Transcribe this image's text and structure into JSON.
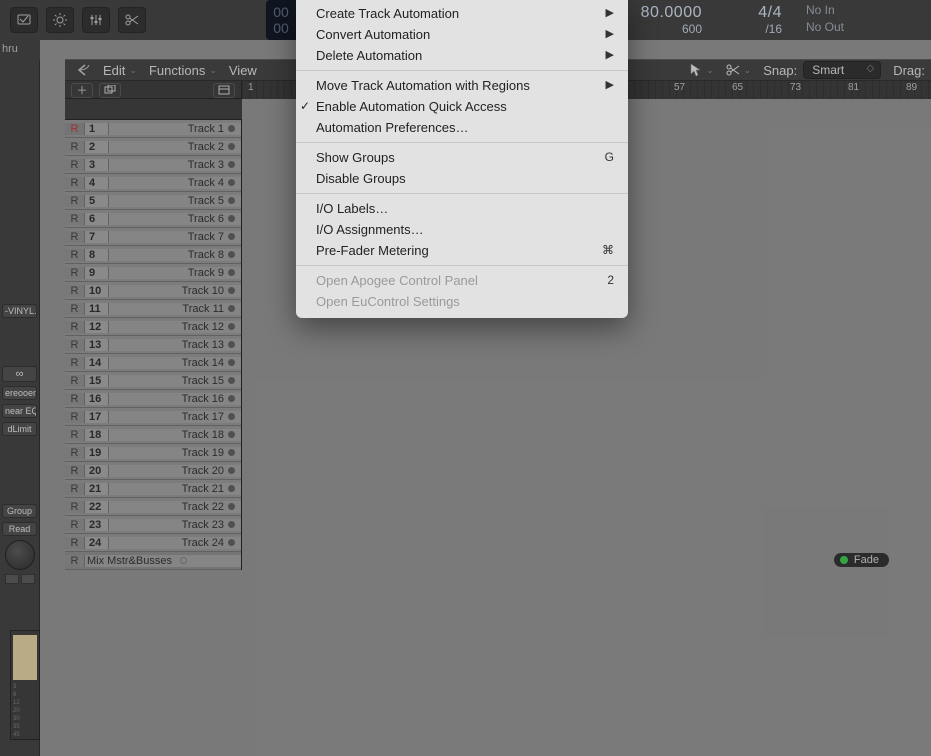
{
  "toolbar": {
    "icons": [
      "screen-icon",
      "sun-icon",
      "sliders-icon",
      "scissors-icon"
    ]
  },
  "lcd": {
    "edge1": "00",
    "edge2": "00",
    "tempo": "80.0000",
    "beat": "600",
    "timesig": "4/4",
    "division": "/16",
    "io_in": "No In",
    "io_out": "No Out"
  },
  "left_header": "hru",
  "menubar": {
    "edit": "Edit",
    "functions": "Functions",
    "view": "View",
    "snap_label": "Snap:",
    "snap_value": "Smart",
    "drag_label": "Drag:"
  },
  "ruler": {
    "first_marker": "1",
    "marks": [
      "57",
      "65",
      "73",
      "81",
      "89"
    ]
  },
  "inspector": {
    "chips": [
      "-VINYL…",
      "∞",
      "ereooere",
      "near EQ",
      "dLimit",
      "Group",
      "Read"
    ]
  },
  "tracks": [
    {
      "n": "1",
      "name": "Track 1"
    },
    {
      "n": "2",
      "name": "Track 2"
    },
    {
      "n": "3",
      "name": "Track 3"
    },
    {
      "n": "4",
      "name": "Track 4"
    },
    {
      "n": "5",
      "name": "Track 5"
    },
    {
      "n": "6",
      "name": "Track 6"
    },
    {
      "n": "7",
      "name": "Track 7"
    },
    {
      "n": "8",
      "name": "Track 8"
    },
    {
      "n": "9",
      "name": "Track 9"
    },
    {
      "n": "10",
      "name": "Track 10"
    },
    {
      "n": "11",
      "name": "Track 11"
    },
    {
      "n": "12",
      "name": "Track 12"
    },
    {
      "n": "13",
      "name": "Track 13"
    },
    {
      "n": "14",
      "name": "Track 14"
    },
    {
      "n": "15",
      "name": "Track 15"
    },
    {
      "n": "16",
      "name": "Track 16"
    },
    {
      "n": "17",
      "name": "Track 17"
    },
    {
      "n": "18",
      "name": "Track 18"
    },
    {
      "n": "19",
      "name": "Track 19"
    },
    {
      "n": "20",
      "name": "Track 20"
    },
    {
      "n": "21",
      "name": "Track 21"
    },
    {
      "n": "22",
      "name": "Track 22"
    },
    {
      "n": "23",
      "name": "Track 23"
    },
    {
      "n": "24",
      "name": "Track 24"
    }
  ],
  "master_track": "Mix Mstr&Busses",
  "fade_badge": "Fade",
  "mini_scale": [
    "3",
    "6",
    "12",
    "20",
    "30",
    "35",
    "45"
  ],
  "menu": {
    "items": [
      {
        "label": "Create Track Automation",
        "sub": true,
        "disabled": false
      },
      {
        "label": "Convert Automation",
        "sub": true
      },
      {
        "label": "Delete Automation",
        "sub": true
      },
      {
        "sep": true
      },
      {
        "label": "Move Track Automation with Regions",
        "sub": true
      },
      {
        "label": "Enable Automation Quick Access",
        "checked": true
      },
      {
        "label": "Automation Preferences…"
      },
      {
        "sep": true
      },
      {
        "label": "Show Groups",
        "shortcut": "G"
      },
      {
        "label": "Disable Groups"
      },
      {
        "sep": true
      },
      {
        "label": "I/O Labels…"
      },
      {
        "label": "I/O Assignments…"
      },
      {
        "label": "Pre-Fader Metering",
        "shortcut": "⌘"
      },
      {
        "sep": true
      },
      {
        "label": "Open Apogee Control Panel",
        "shortcut": "2",
        "disabled": true
      },
      {
        "label": "Open EuControl Settings",
        "disabled": true
      }
    ]
  }
}
